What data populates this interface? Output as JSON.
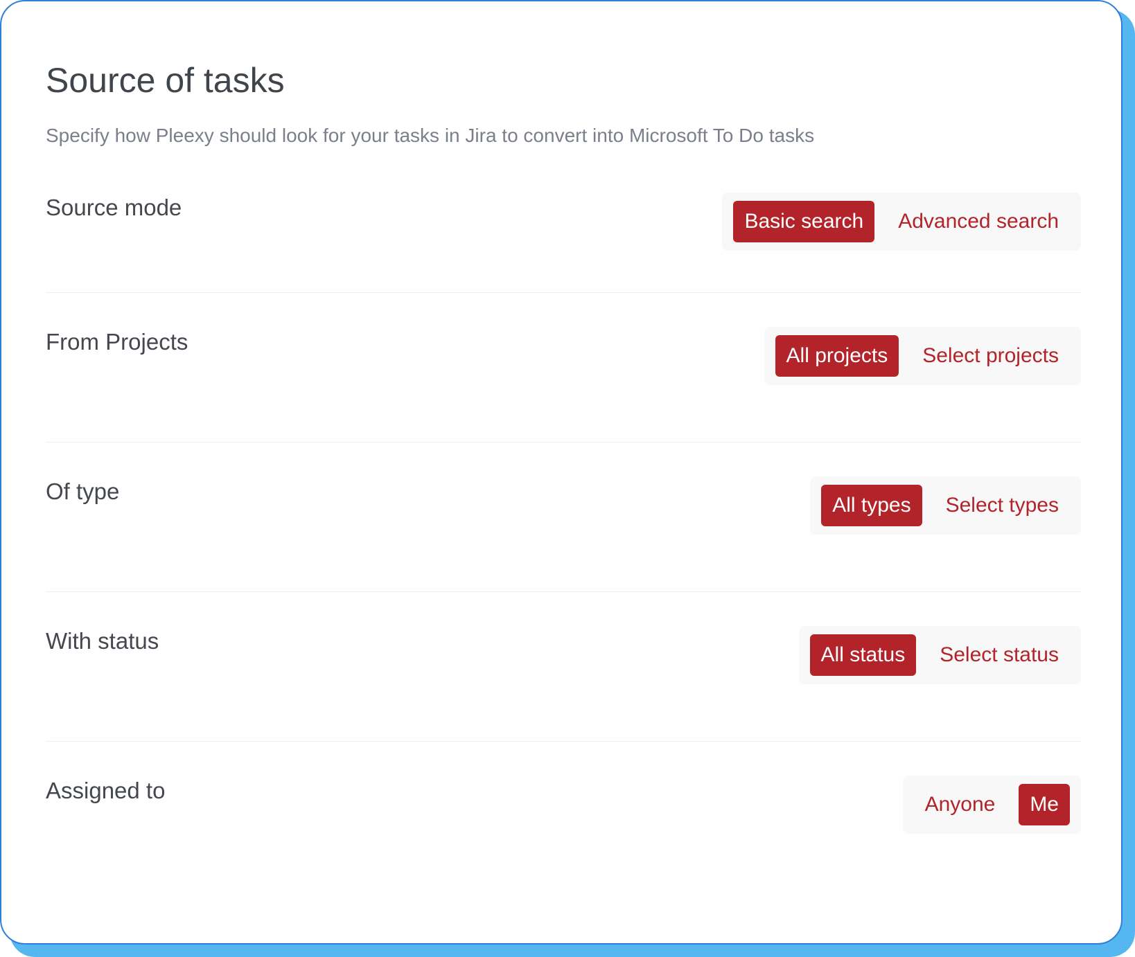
{
  "header": {
    "title": "Source of tasks",
    "subtitle": "Specify how Pleexy should look for your tasks in Jira to convert into Microsoft To Do tasks"
  },
  "rows": [
    {
      "label": "Source mode",
      "options": [
        {
          "label": "Basic search",
          "selected": true
        },
        {
          "label": "Advanced search",
          "selected": false
        }
      ]
    },
    {
      "label": "From Projects",
      "options": [
        {
          "label": "All projects",
          "selected": true
        },
        {
          "label": "Select projects",
          "selected": false
        }
      ]
    },
    {
      "label": "Of type",
      "options": [
        {
          "label": "All types",
          "selected": true
        },
        {
          "label": "Select types",
          "selected": false
        }
      ]
    },
    {
      "label": "With status",
      "options": [
        {
          "label": "All status",
          "selected": true
        },
        {
          "label": "Select status",
          "selected": false
        }
      ]
    },
    {
      "label": "Assigned to",
      "options": [
        {
          "label": "Anyone",
          "selected": false
        },
        {
          "label": "Me",
          "selected": true
        }
      ]
    }
  ],
  "colors": {
    "accent": "#b3232a",
    "frame": "#2f7fd6",
    "shadow": "#55b6f0"
  }
}
